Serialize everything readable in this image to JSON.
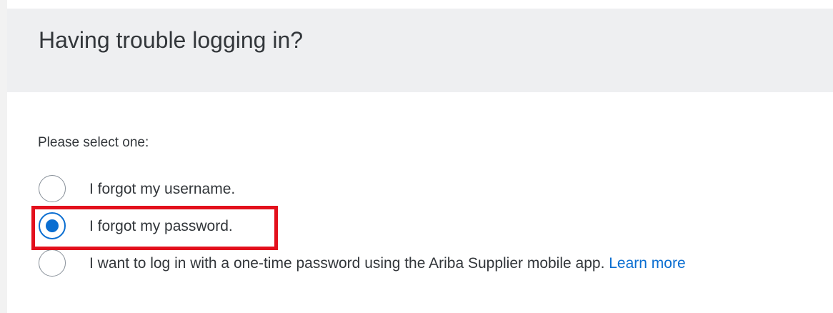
{
  "header": {
    "title": "Having trouble logging in?"
  },
  "form": {
    "prompt": "Please select one:",
    "options": [
      {
        "label": "I forgot my username.",
        "selected": false
      },
      {
        "label": "I forgot my password.",
        "selected": true
      },
      {
        "label": "I want to log in with a one-time password using the Ariba Supplier mobile app.",
        "link": "Learn more",
        "selected": false
      }
    ]
  },
  "colors": {
    "accent": "#0a6ed1",
    "highlight": "#e3101c",
    "header_bg": "#eeeff1",
    "text": "#32363a"
  },
  "icons": {
    "radio_unchecked": "radio-unchecked-icon",
    "radio_checked": "radio-checked-icon"
  }
}
